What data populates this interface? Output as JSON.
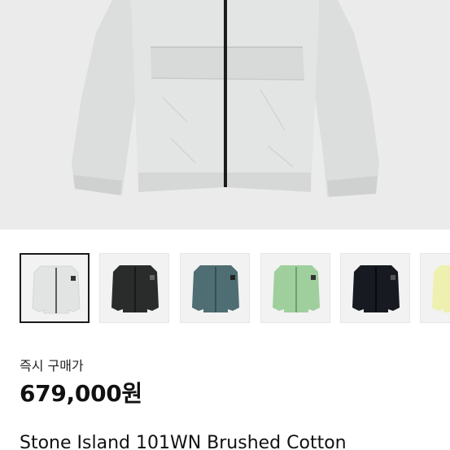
{
  "product": {
    "instant_buy_label": "즉시 구매가",
    "price": "679,000원",
    "title": "Stone Island 101WN Brushed Cotton"
  },
  "gallery": {
    "thumbnails": [
      {
        "color_name": "light grey",
        "color": "#e4e6e6",
        "selected": true
      },
      {
        "color_name": "black",
        "color": "#2a2c2b",
        "selected": false
      },
      {
        "color_name": "teal",
        "color": "#4f6e74",
        "selected": false
      },
      {
        "color_name": "mint green",
        "color": "#9fcf9c",
        "selected": false
      },
      {
        "color_name": "navy black",
        "color": "#181a22",
        "selected": false
      },
      {
        "color_name": "pale yellow",
        "color": "#eef0b0",
        "selected": false
      }
    ]
  },
  "colors": {
    "hero_background": "#ebebeb",
    "hero_jacket": "#dfe1e1",
    "zipper": "#1b1b1b",
    "text": "#111111"
  }
}
